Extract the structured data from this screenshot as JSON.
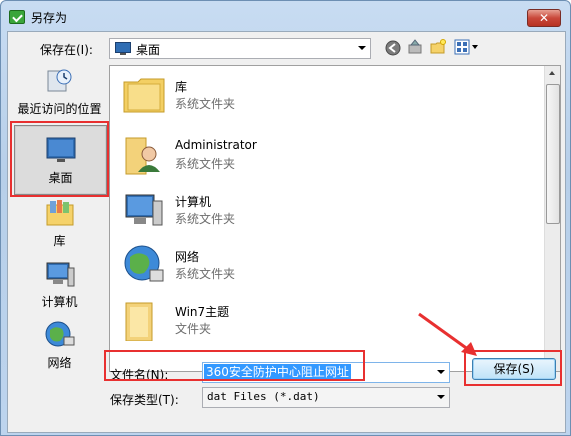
{
  "window": {
    "title": "另存为",
    "close_glyph": "✕"
  },
  "toolbar": {
    "save_in_label": "保存在(I):",
    "location": "桌面",
    "icons": [
      "back-icon",
      "up-folder-icon",
      "new-folder-icon",
      "view-menu-icon"
    ]
  },
  "places": [
    {
      "label": "最近访问的位置",
      "icon": "recent-places-icon"
    },
    {
      "label": "桌面",
      "icon": "desktop-icon",
      "selected": true
    },
    {
      "label": "库",
      "icon": "libraries-icon"
    },
    {
      "label": "计算机",
      "icon": "computer-icon"
    },
    {
      "label": "网络",
      "icon": "network-icon"
    }
  ],
  "files": [
    {
      "name": "库",
      "type": "系统文件夹",
      "icon": "libraries-folder-icon"
    },
    {
      "name": "Administrator",
      "type": "系统文件夹",
      "icon": "user-folder-icon"
    },
    {
      "name": "计算机",
      "type": "系统文件夹",
      "icon": "computer-icon"
    },
    {
      "name": "网络",
      "type": "系统文件夹",
      "icon": "network-globe-icon"
    },
    {
      "name": "Win7主题",
      "type": "文件夹",
      "icon": "folder-icon"
    }
  ],
  "filename": {
    "label": "文件名(N):",
    "value": "360安全防护中心阻止网址"
  },
  "filetype": {
    "label": "保存类型(T):",
    "value": "dat Files (*.dat)"
  },
  "buttons": {
    "save": "保存(S)"
  },
  "colors": {
    "highlight_red": "#e83030",
    "selection_blue": "#3399ff"
  }
}
